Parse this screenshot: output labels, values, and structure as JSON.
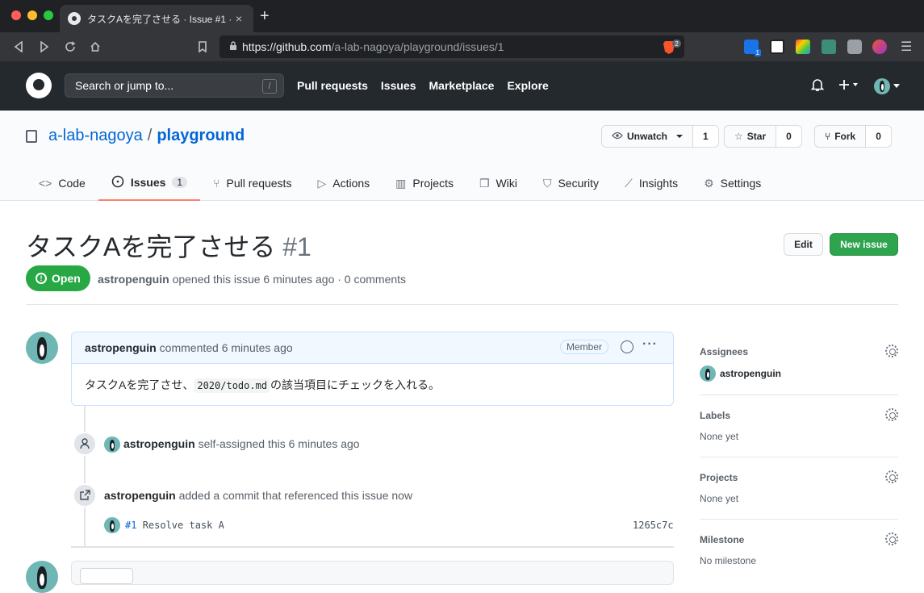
{
  "browser": {
    "tab_title": "タスクAを完了させる · Issue #1 ·",
    "tab_close": "×",
    "new_tab": "+",
    "url_host": "https://github.com",
    "url_path": "/a-lab-nagoya/playground/issues/1",
    "brave_count": "2",
    "ext_badge": "1",
    "menu": "☰"
  },
  "header": {
    "search_placeholder": "Search or jump to...",
    "search_key": "/",
    "nav": [
      "Pull requests",
      "Issues",
      "Marketplace",
      "Explore"
    ]
  },
  "repo": {
    "owner": "a-lab-nagoya",
    "separator": "/",
    "name": "playground",
    "unwatch_label": "Unwatch",
    "watch_count": "1",
    "star_label": "Star",
    "star_count": "0",
    "fork_label": "Fork",
    "fork_count": "0",
    "tabs": [
      {
        "label": "Code",
        "icon": "<>"
      },
      {
        "label": "Issues",
        "icon": "!",
        "count": "1"
      },
      {
        "label": "Pull requests",
        "icon": "⑂"
      },
      {
        "label": "Actions",
        "icon": "▷"
      },
      {
        "label": "Projects",
        "icon": "▥"
      },
      {
        "label": "Wiki",
        "icon": "❐"
      },
      {
        "label": "Security",
        "icon": "⛉"
      },
      {
        "label": "Insights",
        "icon": "⟋"
      },
      {
        "label": "Settings",
        "icon": "⚙"
      }
    ]
  },
  "issue": {
    "title": "タスクAを完了させる",
    "number": "#1",
    "edit_label": "Edit",
    "new_issue_label": "New issue",
    "state": "Open",
    "author": "astropenguin",
    "meta_text": "opened this issue 6 minutes ago · 0 comments"
  },
  "comment": {
    "author": "astropenguin",
    "time": "commented 6 minutes ago",
    "badge": "Member",
    "more": "···",
    "body_before": "タスクAを完了させ、",
    "body_code": "2020/todo.md",
    "body_after": "の該当項目にチェックを入れる。"
  },
  "events": {
    "assign_actor": "astropenguin",
    "assign_text": "self-assigned this 6 minutes ago",
    "ref_actor": "astropenguin",
    "ref_text": "added a commit that referenced this issue now",
    "commit_ref": "#1",
    "commit_msg": "Resolve task A",
    "commit_sha": "1265c7c"
  },
  "sidebar": {
    "assignees_heading": "Assignees",
    "assignee": "astropenguin",
    "labels_heading": "Labels",
    "labels_value": "None yet",
    "projects_heading": "Projects",
    "projects_value": "None yet",
    "milestone_heading": "Milestone",
    "milestone_value": "No milestone"
  },
  "colors": {
    "header_bg": "#24292e",
    "open_green": "#28a745",
    "new_issue_green": "#2ea44f",
    "link_blue": "#0366d6",
    "active_tab_underline": "#f9826c"
  }
}
